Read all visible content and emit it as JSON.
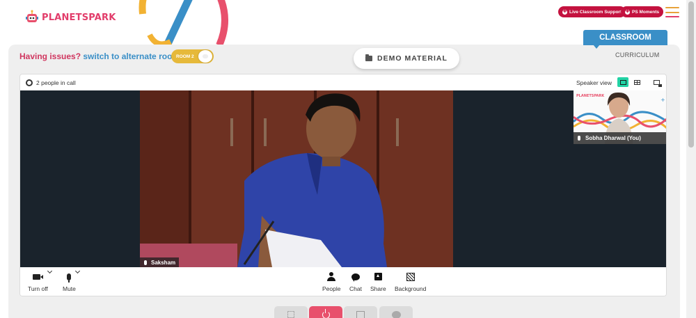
{
  "brand": {
    "logo_text_planet": "PLANET",
    "logo_text_spark": "SPARK"
  },
  "header": {
    "live_support_label": "Live Classroom Support",
    "ps_moments_label": "PS Moments"
  },
  "tabs": {
    "classroom": "CLASSROOM",
    "curriculum": "CURRICULUM"
  },
  "issues": {
    "prefix": "Having issues?",
    "switch_text": "switch to alternate room",
    "room_toggle_label": "ROOM 2"
  },
  "demo_material_label": "DEMO MATERIAL",
  "call": {
    "people_count": "2 people in call",
    "speaker_view_label": "Speaker view",
    "main_participant": "Saksham",
    "self_participant": "Sobha Dharwal (You)",
    "pip_logo_text": "PLANETSPARK"
  },
  "controls": {
    "turn_off": "Turn off",
    "mute": "Mute",
    "people": "People",
    "chat": "Chat",
    "share": "Share",
    "background": "Background"
  },
  "colors": {
    "brand_red": "#c4123f",
    "classroom_blue": "#3a8fc7",
    "speaker_view_active": "#22d3a5",
    "end_call_tab": "#e8506c"
  }
}
